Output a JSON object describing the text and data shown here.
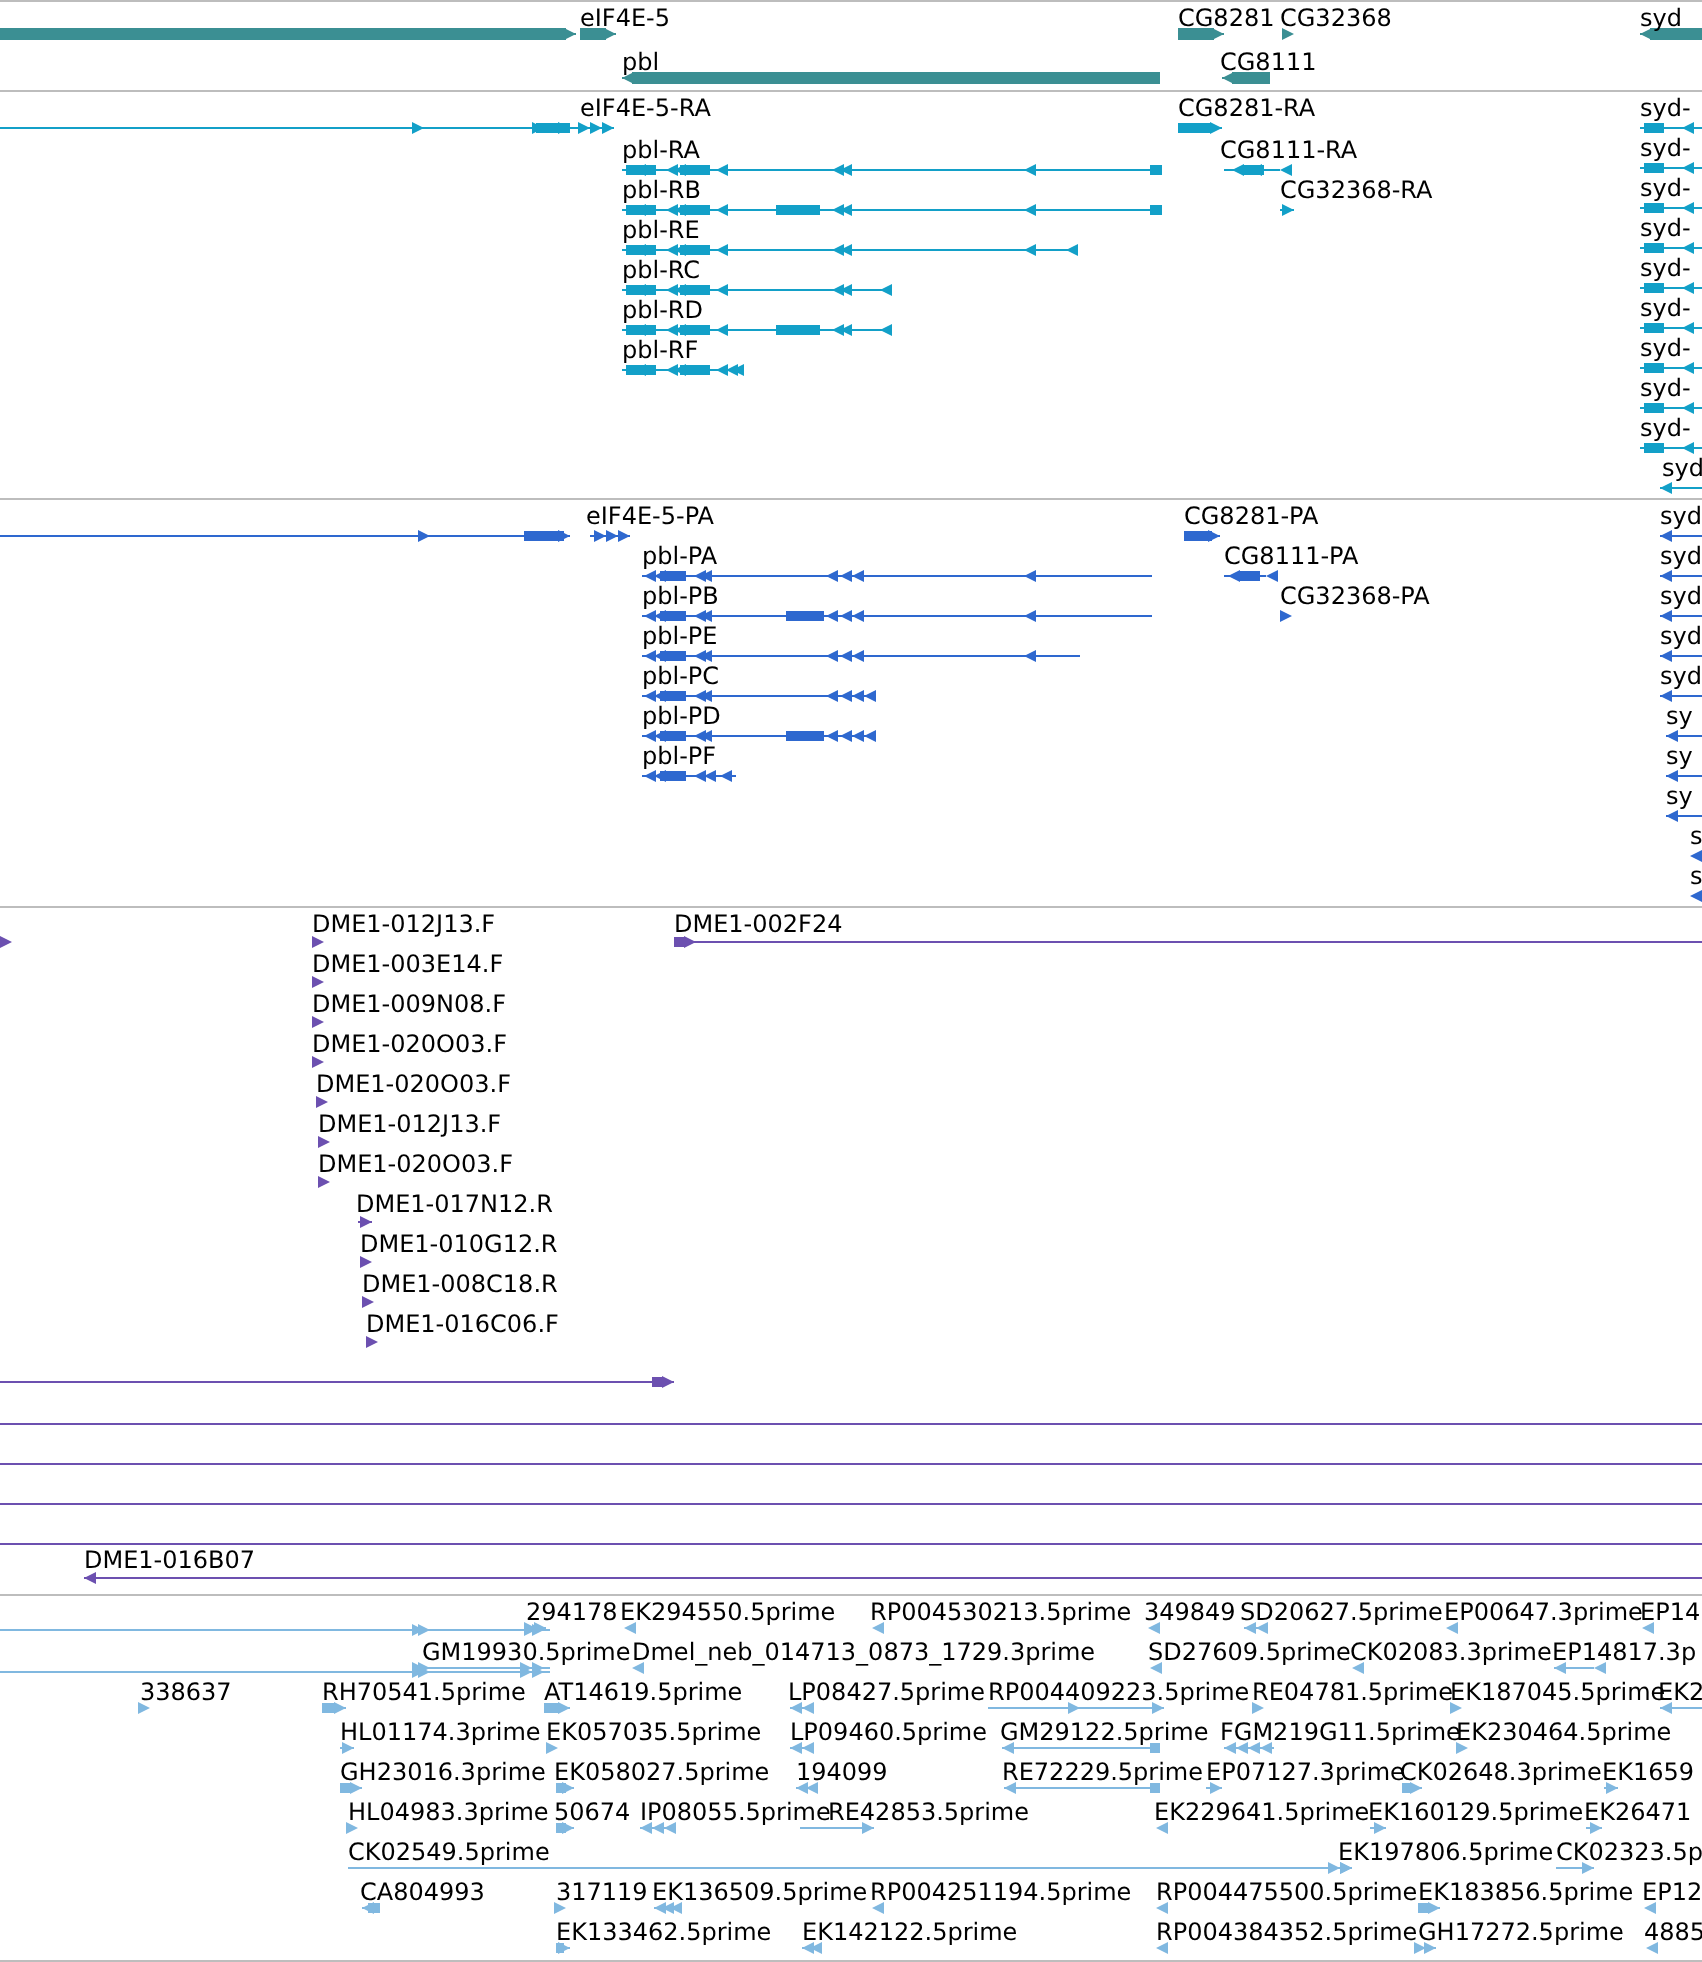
{
  "tracks": [
    {
      "features": [
        {
          "label": "eIF4E-5"
        },
        {
          "label": "CG8281"
        },
        {
          "label": "CG32368"
        },
        {
          "label": "syd"
        },
        {
          "label": "pbl"
        },
        {
          "label": "CG8111"
        }
      ]
    },
    {
      "features": [
        {
          "label": "eIF4E-5-RA"
        },
        {
          "label": "CG8281-RA"
        },
        {
          "label": "pbl-RA"
        },
        {
          "label": "CG8111-RA"
        },
        {
          "label": "pbl-RB"
        },
        {
          "label": "CG32368-RA"
        },
        {
          "label": "pbl-RE"
        },
        {
          "label": "pbl-RC"
        },
        {
          "label": "pbl-RD"
        },
        {
          "label": "pbl-RF"
        },
        {
          "label": "syd-"
        },
        {
          "label": "syd-"
        },
        {
          "label": "syd-"
        },
        {
          "label": "syd-"
        },
        {
          "label": "syd-"
        },
        {
          "label": "syd-"
        },
        {
          "label": "syd-"
        },
        {
          "label": "syd-"
        },
        {
          "label": "syd-"
        },
        {
          "label": "syd"
        }
      ]
    },
    {
      "features": [
        {
          "label": "eIF4E-5-PA"
        },
        {
          "label": "CG8281-PA"
        },
        {
          "label": "pbl-PA"
        },
        {
          "label": "CG8111-PA"
        },
        {
          "label": "pbl-PB"
        },
        {
          "label": "CG32368-PA"
        },
        {
          "label": "pbl-PE"
        },
        {
          "label": "pbl-PC"
        },
        {
          "label": "pbl-PD"
        },
        {
          "label": "pbl-PF"
        },
        {
          "label": "syd"
        },
        {
          "label": "syd"
        },
        {
          "label": "syd"
        },
        {
          "label": "syd"
        },
        {
          "label": "syd"
        },
        {
          "label": "sy"
        },
        {
          "label": "sy"
        },
        {
          "label": "sy"
        },
        {
          "label": "s"
        },
        {
          "label": "s"
        }
      ]
    },
    {
      "features": [
        {
          "label": "DME1-012J13.F"
        },
        {
          "label": "DME1-002F24"
        },
        {
          "label": "DME1-003E14.F"
        },
        {
          "label": "DME1-009N08.F"
        },
        {
          "label": "DME1-020O03.F"
        },
        {
          "label": "DME1-020O03.F"
        },
        {
          "label": "DME1-012J13.F"
        },
        {
          "label": "DME1-020O03.F"
        },
        {
          "label": "DME1-017N12.R"
        },
        {
          "label": "DME1-010G12.R"
        },
        {
          "label": "DME1-008C18.R"
        },
        {
          "label": "DME1-016C06.F"
        },
        {
          "label": "DME1-016B07"
        }
      ]
    },
    {
      "features": [
        {
          "label": "294178"
        },
        {
          "label": "EK294550.5prime"
        },
        {
          "label": "RP004530213.5prime"
        },
        {
          "label": "349849"
        },
        {
          "label": "SD20627.5prime"
        },
        {
          "label": "EP00647.3prime"
        },
        {
          "label": "EP14"
        },
        {
          "label": "GM19930.5prime"
        },
        {
          "label": "Dmel_neb_014713_0873_1729.3prime"
        },
        {
          "label": "SD27609.5prime"
        },
        {
          "label": "CK02083.3prime"
        },
        {
          "label": "EP14817.3p"
        },
        {
          "label": "338637"
        },
        {
          "label": "RH70541.5prime"
        },
        {
          "label": "AT14619.5prime"
        },
        {
          "label": "LP08427.5prime"
        },
        {
          "label": "RP004409223.5prime"
        },
        {
          "label": "RE04781.5prime"
        },
        {
          "label": "EK187045.5prime"
        },
        {
          "label": "EK2"
        },
        {
          "label": "HL01174.3prime"
        },
        {
          "label": "EK057035.5prime"
        },
        {
          "label": "LP09460.5prime"
        },
        {
          "label": "GM29122.5prime"
        },
        {
          "label": "FGM219G11.5prime"
        },
        {
          "label": "EK230464.5prime"
        },
        {
          "label": "GH23016.3prime"
        },
        {
          "label": "EK058027.5prime"
        },
        {
          "label": "194099"
        },
        {
          "label": "RE72229.5prime"
        },
        {
          "label": "EP07127.3prime"
        },
        {
          "label": "CK02648.3prime"
        },
        {
          "label": "EK1659"
        },
        {
          "label": "HL04983.3prime"
        },
        {
          "label": "50674"
        },
        {
          "label": "IP08055.5prime"
        },
        {
          "label": "RE42853.5prime"
        },
        {
          "label": "EK229641.5prime"
        },
        {
          "label": "EK160129.5prime"
        },
        {
          "label": "EK26471"
        },
        {
          "label": "CK02549.5prime"
        },
        {
          "label": "EK197806.5prime"
        },
        {
          "label": "CK02323.5p"
        },
        {
          "label": "CA804993"
        },
        {
          "label": "317119"
        },
        {
          "label": "EK136509.5prime"
        },
        {
          "label": "RP004251194.5prime"
        },
        {
          "label": "RP004475500.5prime"
        },
        {
          "label": "EK183856.5prime"
        },
        {
          "label": "EP12"
        },
        {
          "label": "EK133462.5prime"
        },
        {
          "label": "EK142122.5prime"
        },
        {
          "label": "RP004384352.5prime"
        },
        {
          "label": "GH17272.5prime"
        },
        {
          "label": "4885"
        }
      ]
    }
  ]
}
